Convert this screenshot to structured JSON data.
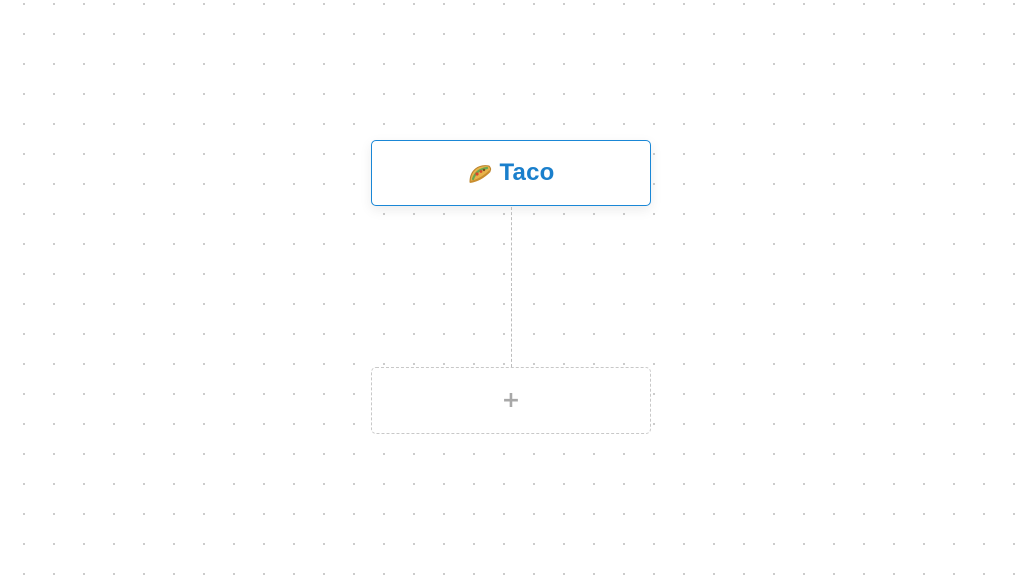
{
  "canvas": {
    "node": {
      "icon": "taco-emoji-icon",
      "label": "Taco",
      "accent_color": "#1a7fcc"
    },
    "add_node": {
      "icon": "plus-icon",
      "symbol": "+"
    }
  }
}
